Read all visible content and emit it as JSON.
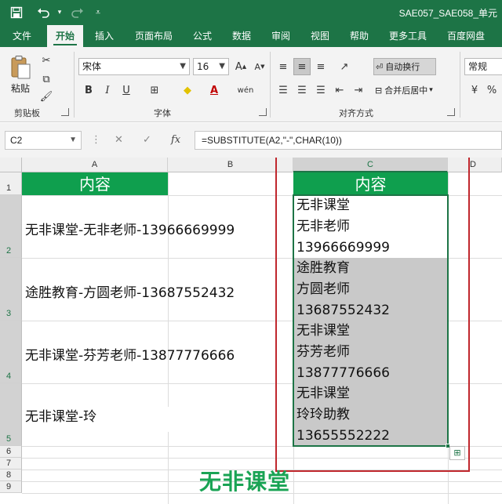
{
  "window": {
    "title": "SAE057_SAE058_单元",
    "accent": "#1d7446"
  },
  "quick_access": {
    "save_icon": "save-icon",
    "undo_icon": "undo-icon",
    "redo_icon": "redo-icon",
    "customize_icon": "chevron-down-icon"
  },
  "tabs": [
    {
      "label": "文件"
    },
    {
      "label": "开始"
    },
    {
      "label": "插入"
    },
    {
      "label": "页面布局"
    },
    {
      "label": "公式"
    },
    {
      "label": "数据"
    },
    {
      "label": "审阅"
    },
    {
      "label": "视图"
    },
    {
      "label": "帮助"
    },
    {
      "label": "更多工具"
    },
    {
      "label": "百度网盘"
    }
  ],
  "ribbon": {
    "clipboard": {
      "paste_label": "粘贴",
      "group_label": "剪贴板"
    },
    "font": {
      "font_name": "宋体",
      "font_size": "16",
      "group_label": "字体"
    },
    "alignment": {
      "wrap_label": "自动换行",
      "merge_label": "合并后居中",
      "group_label": "对齐方式"
    },
    "number": {
      "format": "常规"
    }
  },
  "formula_bar": {
    "name_box": "C2",
    "fx_label": "fx",
    "formula": "=SUBSTITUTE(A2,\"-\",CHAR(10))"
  },
  "columns": [
    "A",
    "B",
    "C",
    "D"
  ],
  "rows": [
    "1",
    "2",
    "3",
    "4",
    "5",
    "6",
    "7",
    "8",
    "9"
  ],
  "sheet": {
    "header_label": "内容",
    "header_label_c": "内容",
    "a_cells": [
      "无非课堂-无非老师-13966669999",
      "途胜教育-方圆老师-13687552432",
      "无非课堂-芬芳老师-13877776666",
      "无非课堂-玲"
    ],
    "c_cells": [
      [
        "无非课堂",
        "无非老师",
        "13966669999"
      ],
      [
        "途胜教育",
        "方圆老师",
        "13687552432"
      ],
      [
        "无非课堂",
        "芬芳老师",
        "13877776666"
      ],
      [
        "无非课堂",
        "玲玲助教",
        "13655552222"
      ]
    ],
    "header_color": "#0f9f4e",
    "selection_color": "#c9c9c9",
    "highlight_color": "#c0272d"
  },
  "watermark": "无非课堂"
}
